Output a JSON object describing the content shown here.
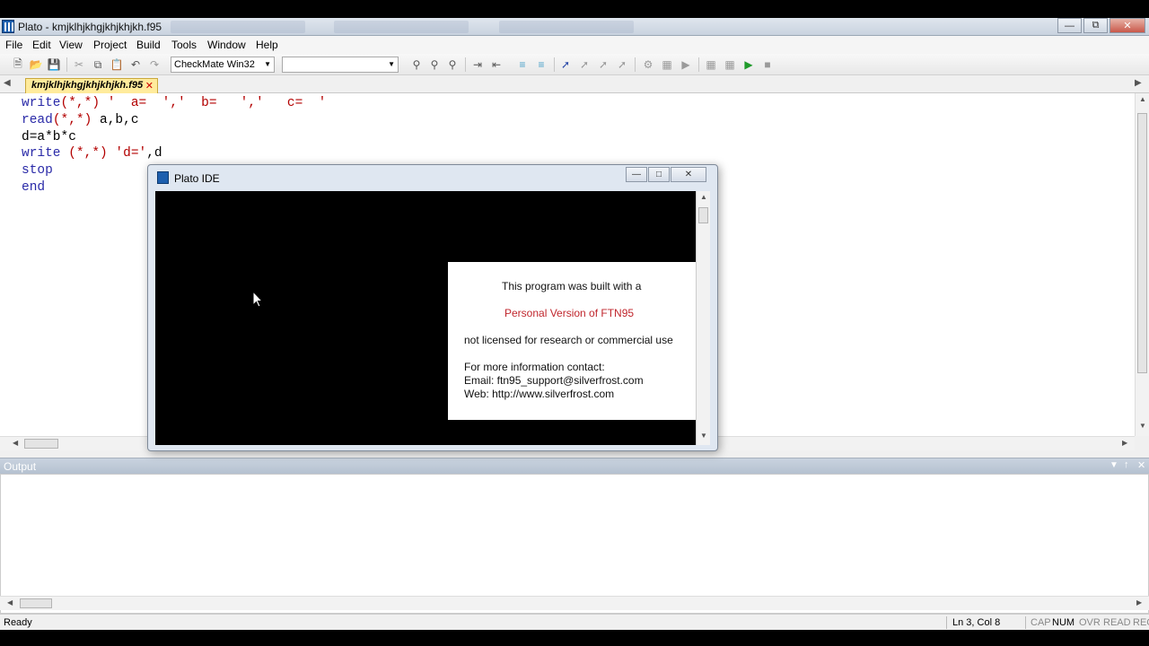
{
  "window": {
    "title": "Plato - kmjklhjkhgjkhjkhjkh.f95",
    "controls": {
      "minimize": "—",
      "restore": "⧉",
      "close": "✕"
    }
  },
  "menu": [
    "File",
    "Edit",
    "View",
    "Project",
    "Build",
    "Tools",
    "Window",
    "Help"
  ],
  "toolbar": {
    "config_combo": "CheckMate Win32",
    "target_combo": ""
  },
  "editor": {
    "tab_label": "kmjklhjkhgjkhjkhjkh.f95",
    "tab_close": "✕",
    "lines": [
      [
        {
          "t": "write",
          "c": "kw"
        },
        {
          "t": "(*,*)",
          "c": "str"
        },
        {
          "t": " '  a=  ','  b=   ','   c=  '",
          "c": "str"
        }
      ],
      [
        {
          "t": "read",
          "c": "kw"
        },
        {
          "t": "(*,*)",
          "c": "str"
        },
        {
          "t": " a,b,c",
          "c": "pl"
        }
      ],
      [
        {
          "t": "d=a*b*c",
          "c": "pl"
        }
      ],
      [
        {
          "t": "write",
          "c": "kw"
        },
        {
          "t": " (*,*) 'd='",
          "c": "str"
        },
        {
          "t": ",d",
          "c": "pl"
        }
      ],
      [
        {
          "t": "stop",
          "c": "kw"
        }
      ],
      [
        {
          "t": "end",
          "c": "kw"
        }
      ]
    ]
  },
  "output_panel": {
    "title": "Output"
  },
  "dialog": {
    "title": "Plato IDE",
    "notice": {
      "line1": "This program was built with a",
      "line2": "Personal Version of FTN95",
      "line3": "not licensed for research or commercial use",
      "line4": "For more information contact:",
      "line5": "Email: ftn95_support@silverfrost.com",
      "line6": "Web: http://www.silverfrost.com"
    }
  },
  "status": {
    "ready": "Ready",
    "position": "Ln 3, Col 8",
    "indicators": [
      "CAP",
      "NUM",
      "OVR",
      "READ",
      "REC"
    ]
  },
  "colors": {
    "keyword": "#2a2aa8",
    "string": "#b30000",
    "tab_active": "#ffeb9c",
    "notice_highlight": "#c0262d"
  }
}
